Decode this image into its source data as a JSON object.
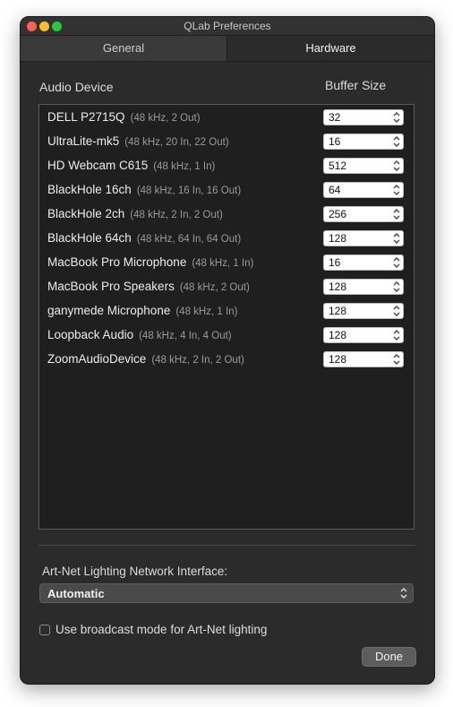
{
  "window": {
    "title": "QLab Preferences"
  },
  "tabs": [
    {
      "label": "General",
      "selected": false
    },
    {
      "label": "Hardware",
      "selected": true
    }
  ],
  "audio": {
    "device_header": "Audio Device",
    "buffer_header": "Buffer Size",
    "devices": [
      {
        "name": "DELL P2715Q",
        "info": "(48 kHz, 2 Out)",
        "buffer": "32"
      },
      {
        "name": "UltraLite-mk5",
        "info": "(48 kHz, 20 In, 22 Out)",
        "buffer": "16"
      },
      {
        "name": "HD Webcam C615",
        "info": "(48 kHz, 1 In)",
        "buffer": "512"
      },
      {
        "name": "BlackHole 16ch",
        "info": "(48 kHz, 16 In, 16 Out)",
        "buffer": "64"
      },
      {
        "name": "BlackHole 2ch",
        "info": "(48 kHz, 2 In, 2 Out)",
        "buffer": "256"
      },
      {
        "name": "BlackHole 64ch",
        "info": "(48 kHz, 64 In, 64 Out)",
        "buffer": "128"
      },
      {
        "name": "MacBook Pro Microphone",
        "info": "(48 kHz, 1 In)",
        "buffer": "16"
      },
      {
        "name": "MacBook Pro Speakers",
        "info": "(48 kHz, 2 Out)",
        "buffer": "128"
      },
      {
        "name": "ganymede Microphone",
        "info": "(48 kHz, 1 In)",
        "buffer": "128"
      },
      {
        "name": "Loopback Audio",
        "info": "(48 kHz, 4 In, 4 Out)",
        "buffer": "128"
      },
      {
        "name": "ZoomAudioDevice",
        "info": "(48 kHz, 2 In, 2 Out)",
        "buffer": "128"
      }
    ]
  },
  "artnet": {
    "label": "Art-Net Lighting Network Interface:",
    "selected": "Automatic",
    "broadcast_label": "Use broadcast mode for Art-Net lighting",
    "broadcast_checked": false
  },
  "buttons": {
    "done": "Done"
  },
  "icons": {
    "stepper": "up-down-chevron-icon"
  }
}
